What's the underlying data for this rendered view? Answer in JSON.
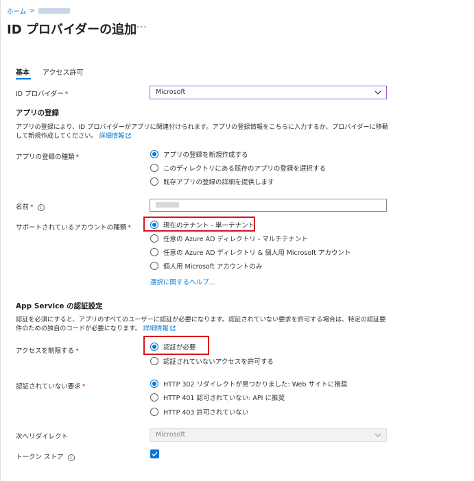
{
  "breadcrumb": {
    "home": "ホーム",
    "separator": ">"
  },
  "page": {
    "title": "ID プロバイダーの追加",
    "more": "···"
  },
  "tabs": [
    {
      "label": "基本"
    },
    {
      "label": "アクセス許可"
    }
  ],
  "identity_provider": {
    "label": "ID プロバイダー",
    "required": "*",
    "value": "Microsoft"
  },
  "app_registration": {
    "title": "アプリの登録",
    "description": "アプリの登録により、ID プロバイダーがアプリに関連付けられます。アプリの登録情報をこちらに入力するか、プロバイダーに移動して新規作成してください。",
    "more_info": "詳細情報",
    "type_label": "アプリの登録の種類",
    "required": "*",
    "type_options": [
      {
        "label": "アプリの登録を新規作成する",
        "selected": true
      },
      {
        "label": "このディレクトリにある既存のアプリの登録を選択する",
        "selected": false
      },
      {
        "label": "既存アプリの登録の詳細を提供します",
        "selected": false
      }
    ]
  },
  "name": {
    "label": "名前",
    "required": "*",
    "info_icon": "info-icon"
  },
  "account_types": {
    "label": "サポートされているアカウントの種類",
    "required": "*",
    "options": [
      {
        "label": "現在のテナント - 単一テナント",
        "selected": true
      },
      {
        "label": "任意の Azure AD ディレクトリ - マルチテナント",
        "selected": false
      },
      {
        "label": "任意の Azure AD ディレクトリ & 個人用 Microsoft アカウント",
        "selected": false
      },
      {
        "label": "個人用 Microsoft アカウントのみ",
        "selected": false
      }
    ],
    "help_link": "選択に関するヘルプ..."
  },
  "auth_settings": {
    "title": "App Service の認証設定",
    "description": "認証を必須にすると、アプリのすべてのユーザーに認証が必要になります。認証されていない要求を許可する場合は、特定の認証要件のための独自のコードが必要になります。",
    "more_info": "詳細情報",
    "restrict_label": "アクセスを制限する",
    "required": "*",
    "restrict_options": [
      {
        "label": "認証が必要",
        "selected": true
      },
      {
        "label": "認証されていないアクセスを許可する",
        "selected": false
      }
    ],
    "unauth_label": "認証されていない要求",
    "unauth_options": [
      {
        "label": "HTTP 302 リダイレクトが見つかりました: Web サイトに推奨",
        "selected": true
      },
      {
        "label": "HTTP 401 認可されていない: API に推奨",
        "selected": false
      },
      {
        "label": "HTTP 403 許可されていない",
        "selected": false
      }
    ],
    "redirect_label": "次へリダイレクト",
    "redirect_value": "Microsoft",
    "token_store_label": "トークン ストア",
    "token_store_checked": true
  },
  "colors": {
    "accent": "#0078d4",
    "highlight": "#d9111d",
    "required": "#a4262c",
    "focus_border": "#a15ad6"
  }
}
